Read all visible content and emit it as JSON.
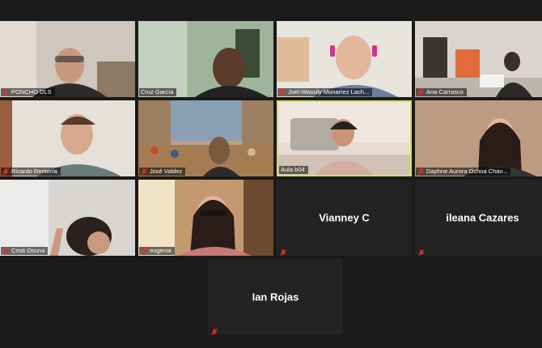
{
  "app": {
    "background": "#1a1a1a",
    "active_speaker_color": "#d6e34c",
    "muted_icon": "muted-mic-icon",
    "muted_icon_color": "#e0302b"
  },
  "participants": [
    {
      "name": "PONCHO DLS",
      "muted": true
    },
    {
      "name": "Cruz García",
      "muted": false
    },
    {
      "name": "Joel-Wassily Monarrez Lach...",
      "muted": true
    },
    {
      "name": "Ana Carrasco",
      "muted": true
    },
    {
      "name": "Ricardo Rentería",
      "muted": true
    },
    {
      "name": "José Valdez",
      "muted": true
    },
    {
      "name": "Aula b04",
      "muted": false,
      "active_speaker": true
    },
    {
      "name": "Daphne Aurora Ochoa Chav...",
      "muted": true
    },
    {
      "name": "Cristi Osuna",
      "muted": true
    },
    {
      "name": "eugenia",
      "muted": true
    },
    {
      "name": "Vianney C",
      "muted": true,
      "video_off": true
    },
    {
      "name": "ileana Cazares",
      "muted": true,
      "video_off": true
    },
    {
      "name": "Ian Rojas",
      "muted": true,
      "video_off": true
    }
  ]
}
